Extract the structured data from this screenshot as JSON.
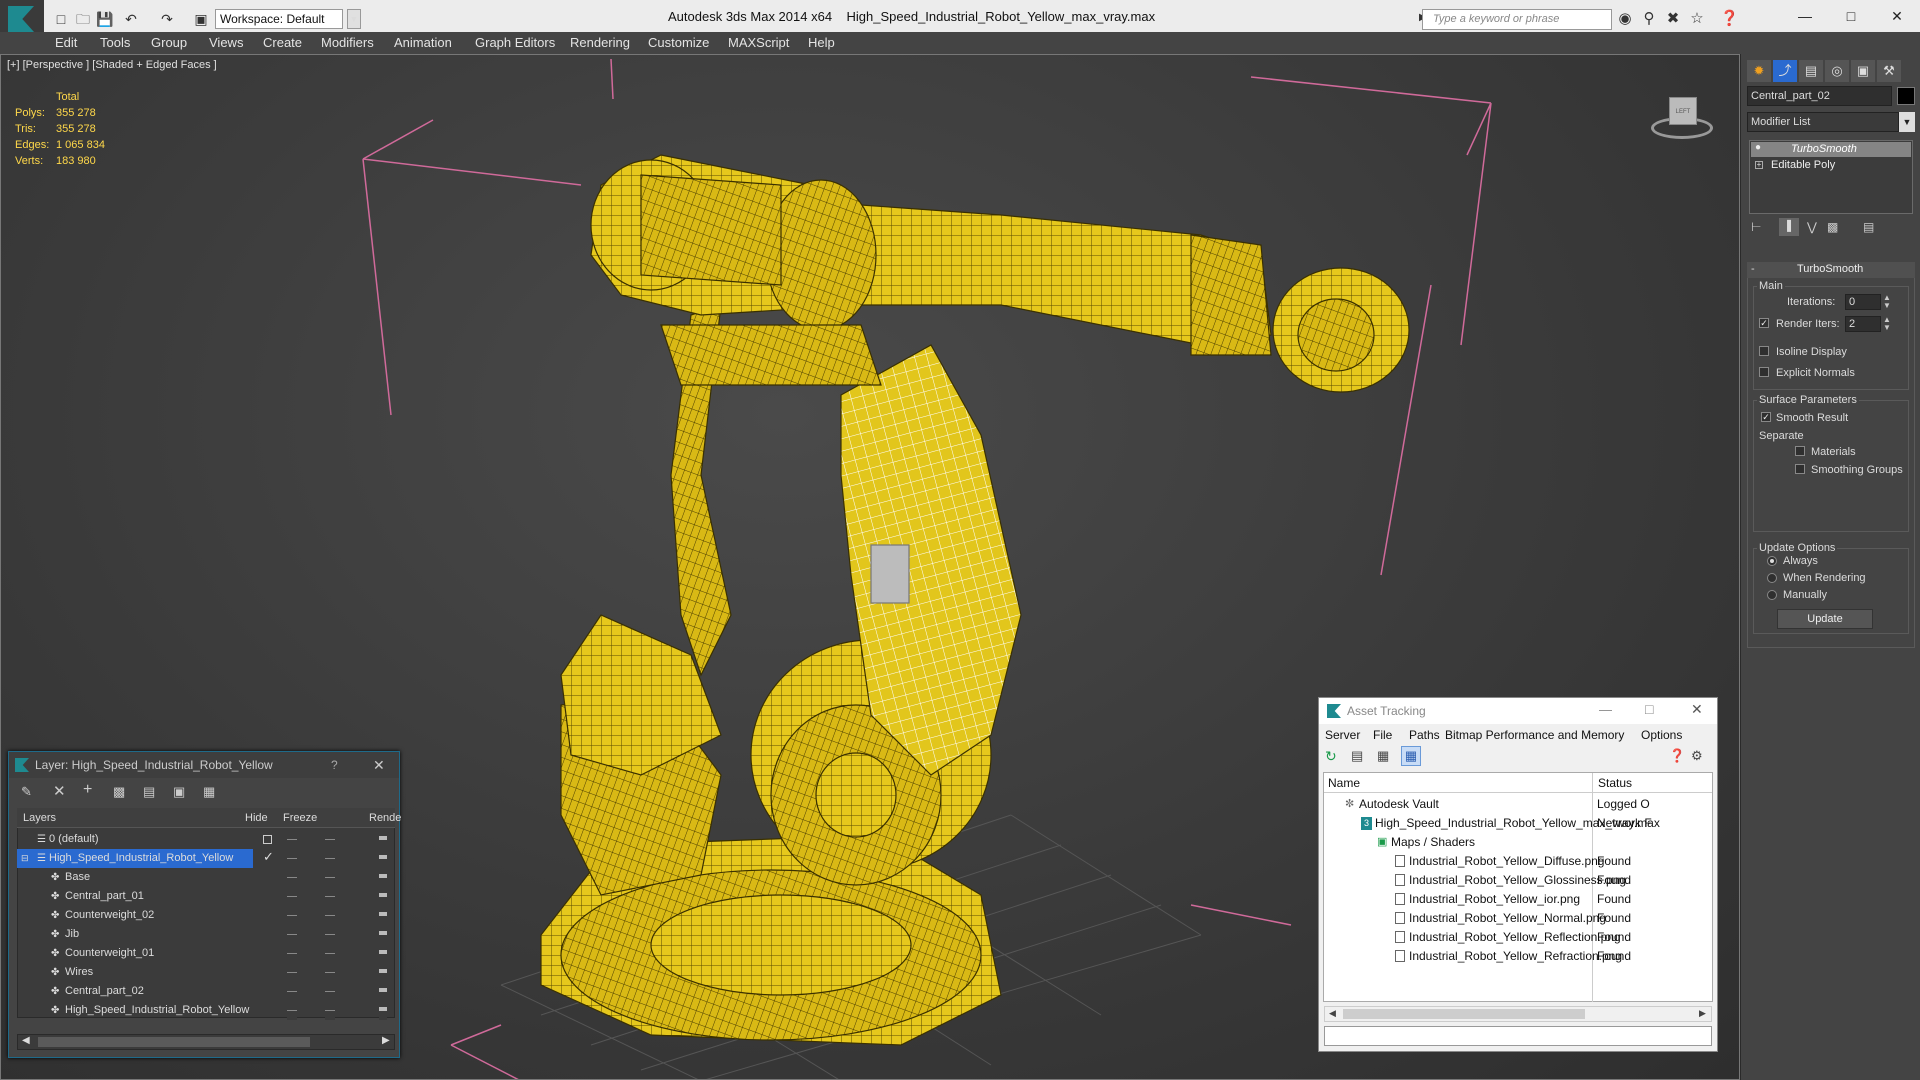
{
  "titlebar": {
    "workspace_label": "Workspace: Default",
    "app_title": "Autodesk 3ds Max  2014 x64",
    "file_title": "High_Speed_Industrial_Robot_Yellow_max_vray.max",
    "search_placeholder": "Type a keyword or phrase"
  },
  "menu": [
    "Edit",
    "Tools",
    "Group",
    "Views",
    "Create",
    "Modifiers",
    "Animation",
    "Graph Editors",
    "Rendering",
    "Customize",
    "MAXScript",
    "Help"
  ],
  "viewport": {
    "label": "[+] [Perspective ] [Shaded + Edged Faces ]",
    "stats_header": "Total",
    "stats": [
      {
        "label": "Polys:",
        "value": "355 278"
      },
      {
        "label": "Tris:",
        "value": "355 278"
      },
      {
        "label": "Edges:",
        "value": "1 065 834"
      },
      {
        "label": "Verts:",
        "value": "183 980"
      }
    ],
    "viewcube_face": "LEFT"
  },
  "command_panel": {
    "object_name": "Central_part_02",
    "modifier_list": "Modifier List",
    "stack": [
      "TurboSmooth",
      "Editable Poly"
    ],
    "rollout_title": "TurboSmooth",
    "main_group": "Main",
    "iterations_label": "Iterations:",
    "iterations_value": "0",
    "render_iters_label": "Render Iters:",
    "render_iters_value": "2",
    "isoline_label": "Isoline Display",
    "explicit_normals_label": "Explicit Normals",
    "surface_group": "Surface Parameters",
    "smooth_result_label": "Smooth Result",
    "separate_label": "Separate",
    "materials_label": "Materials",
    "smoothing_groups_label": "Smoothing Groups",
    "update_group": "Update Options",
    "always_label": "Always",
    "when_rendering_label": "When Rendering",
    "manually_label": "Manually",
    "update_button": "Update"
  },
  "layer_explorer": {
    "title": "Layer: High_Speed_Industrial_Robot_Yellow",
    "help_glyph": "?",
    "columns": [
      "Layers",
      "Hide",
      "Freeze",
      "Rende"
    ],
    "rows": [
      {
        "name": "0 (default)",
        "level": 1
      },
      {
        "name": "High_Speed_Industrial_Robot_Yellow",
        "level": 1,
        "selected": true
      },
      {
        "name": "Base",
        "level": 2
      },
      {
        "name": "Central_part_01",
        "level": 2
      },
      {
        "name": "Counterweight_02",
        "level": 2
      },
      {
        "name": "Jib",
        "level": 2
      },
      {
        "name": "Counterweight_01",
        "level": 2
      },
      {
        "name": "Wires",
        "level": 2
      },
      {
        "name": "Central_part_02",
        "level": 2
      },
      {
        "name": "High_Speed_Industrial_Robot_Yellow",
        "level": 2
      }
    ]
  },
  "asset_tracking": {
    "title": "Asset Tracking",
    "menu": [
      "Server",
      "File",
      "Paths",
      "Bitmap Performance and Memory",
      "Options"
    ],
    "columns": [
      "Name",
      "Status"
    ],
    "rows": [
      {
        "name": "Autodesk Vault",
        "status": "Logged O",
        "level": 0
      },
      {
        "name": "High_Speed_Industrial_Robot_Yellow_max_vray.max",
        "status": "Network F",
        "level": 1
      },
      {
        "name": "Maps / Shaders",
        "status": "",
        "level": 2
      },
      {
        "name": "Industrial_Robot_Yellow_Diffuse.png",
        "status": "Found",
        "level": 3
      },
      {
        "name": "Industrial_Robot_Yellow_Glossiness.png",
        "status": "Found",
        "level": 3
      },
      {
        "name": "Industrial_Robot_Yellow_ior.png",
        "status": "Found",
        "level": 3
      },
      {
        "name": "Industrial_Robot_Yellow_Normal.png",
        "status": "Found",
        "level": 3
      },
      {
        "name": "Industrial_Robot_Yellow_Reflection.png",
        "status": "Found",
        "level": 3
      },
      {
        "name": "Industrial_Robot_Yellow_Refraction.png",
        "status": "Found",
        "level": 3
      }
    ]
  },
  "colors": {
    "robot": "#e8c81a",
    "robot_dark": "#6b5a00",
    "selection_box": "#d06a9a",
    "accent": "#1e8a90",
    "selected_row": "#2a6ad0"
  }
}
